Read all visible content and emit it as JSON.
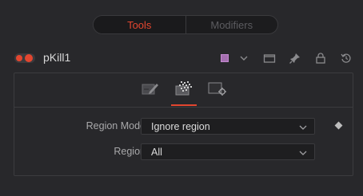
{
  "tabs": {
    "tools_label": "Tools",
    "modifiers_label": "Modifiers",
    "active": "Tools"
  },
  "node": {
    "name": "pKill1",
    "enabled": true,
    "color": "#a56fb0"
  },
  "header_icons": [
    "color-swatch-icon",
    "chevron-down-icon",
    "window-icon",
    "pin-icon",
    "lock-icon",
    "reset-icon"
  ],
  "sub_tabs": [
    "edit-icon",
    "particle-region-icon",
    "settings-icon"
  ],
  "params": {
    "region_mode": {
      "label": "Region Mode",
      "value": "Ignore region"
    },
    "region": {
      "label": "Region",
      "value": "All"
    }
  },
  "colors": {
    "accent": "#e3462f",
    "background": "#28282b",
    "field": "#1e1e20"
  }
}
